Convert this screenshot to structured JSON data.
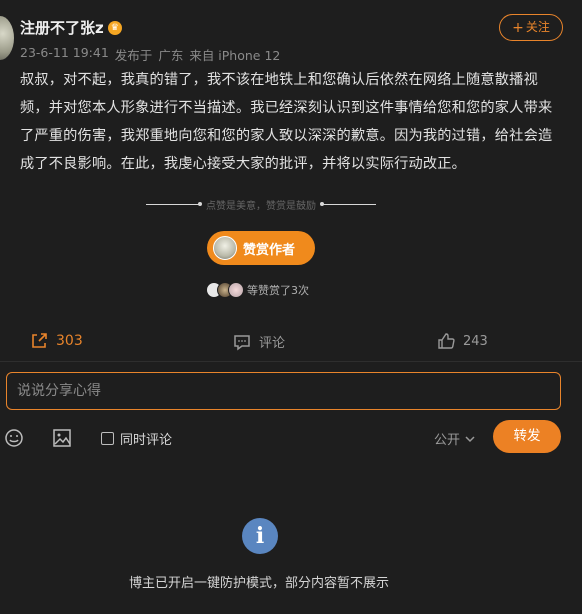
{
  "post": {
    "username": "注册不了张z",
    "date": "23-6-11 19:41",
    "source_prefix": "发布于",
    "location": "广东",
    "device": "来自 iPhone 12",
    "follow_label": "关注",
    "body": "叔叔，对不起，我真的错了，我不该在地铁上和您确认后依然在网络上随意散播视频，并对您本人形象进行不当描述。我已经深刻认识到这件事情给您和您的家人带来了严重的伤害，我郑重地向您和您的家人致以深深的歉意。因为我的过错，给社会造成了不良影响。在此，我虔心接受大家的批评，并将以实际行动改正。"
  },
  "reward": {
    "tagline": "点赞是美意，赞赏是鼓励",
    "button_label": "赞赏作者",
    "summary": "等赞赏了3次"
  },
  "actions": {
    "share_count": "303",
    "comment_label": "评论",
    "like_count": "243"
  },
  "composer": {
    "placeholder": "说说分享心得",
    "sync_comment_label": "同时评论",
    "visibility": "公开",
    "repost_label": "转发"
  },
  "notice": {
    "icon": "i",
    "text": "博主已开启一键防护模式，部分内容暂不展示"
  },
  "colors": {
    "accent": "#e8842b",
    "background": "#1e1e1e",
    "info_blue": "#5a86c0"
  }
}
